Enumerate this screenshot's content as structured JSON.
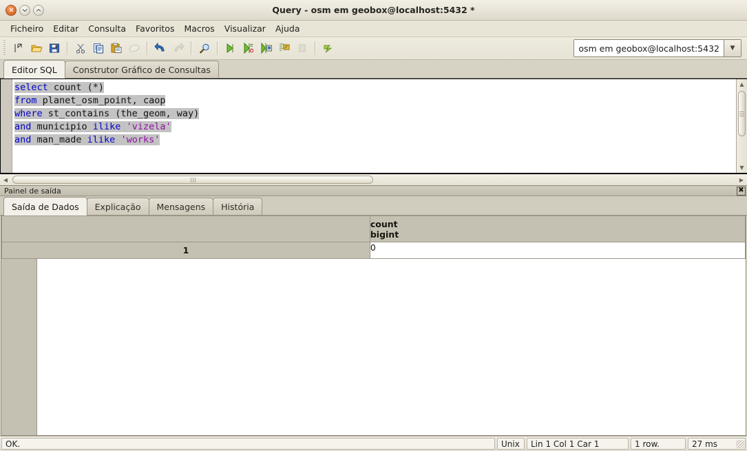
{
  "window": {
    "title": "Query - osm em geobox@localhost:5432 *",
    "buttons": {
      "close": "close-button",
      "minimize": "minimize-button",
      "maximize": "maximize-button"
    }
  },
  "menubar": {
    "items": [
      {
        "label": "Ficheiro"
      },
      {
        "label": "Editar"
      },
      {
        "label": "Consulta"
      },
      {
        "label": "Favoritos"
      },
      {
        "label": "Macros"
      },
      {
        "label": "Visualizar"
      },
      {
        "label": "Ajuda"
      }
    ]
  },
  "toolbar": {
    "connection": {
      "value": "osm em geobox@localhost:5432",
      "arrow": "▼"
    },
    "buttons": [
      {
        "name": "new-query-icon",
        "enabled": true
      },
      {
        "name": "open-file-icon",
        "enabled": true
      },
      {
        "name": "save-file-icon",
        "enabled": true
      },
      {
        "name": "cut-icon",
        "enabled": true
      },
      {
        "name": "copy-icon",
        "enabled": true
      },
      {
        "name": "paste-icon",
        "enabled": true
      },
      {
        "name": "clear-window-icon",
        "enabled": false
      },
      {
        "name": "undo-icon",
        "enabled": true
      },
      {
        "name": "redo-icon",
        "enabled": false
      },
      {
        "name": "find-replace-icon",
        "enabled": true
      },
      {
        "name": "execute-query-icon",
        "enabled": true
      },
      {
        "name": "execute-pgscript-icon",
        "enabled": true
      },
      {
        "name": "execute-to-file-icon",
        "enabled": true
      },
      {
        "name": "explain-query-icon",
        "enabled": true
      },
      {
        "name": "cancel-query-icon",
        "enabled": false
      },
      {
        "name": "explain-options-icon",
        "enabled": true
      }
    ]
  },
  "editor": {
    "tabs": [
      {
        "label": "Editor SQL",
        "active": true
      },
      {
        "label": "Construtor Gráfico de Consultas",
        "active": false
      }
    ],
    "sql_lines": [
      [
        {
          "t": "select",
          "c": "kw"
        },
        {
          "t": " count (*)",
          "c": "plain"
        }
      ],
      [
        {
          "t": "from",
          "c": "kw"
        },
        {
          "t": " planet_osm_point, caop",
          "c": "plain"
        }
      ],
      [
        {
          "t": "where",
          "c": "kw"
        },
        {
          "t": " st_contains (the_geom, way)",
          "c": "plain"
        }
      ],
      [
        {
          "t": "and",
          "c": "kw"
        },
        {
          "t": " municipio ",
          "c": "plain"
        },
        {
          "t": "ilike",
          "c": "kw"
        },
        {
          "t": " ",
          "c": "plain"
        },
        {
          "t": "'vizela'",
          "c": "str"
        }
      ],
      [
        {
          "t": "and",
          "c": "kw"
        },
        {
          "t": " man_made ",
          "c": "plain"
        },
        {
          "t": "ilike",
          "c": "kw"
        },
        {
          "t": " ",
          "c": "plain"
        },
        {
          "t": "'works'",
          "c": "str"
        }
      ]
    ],
    "colors": {
      "keyword": "#0000c8",
      "string": "#9010a0",
      "plain": "#111111",
      "selection": "#c3c3c3"
    }
  },
  "output_panel": {
    "title": "Painel de saída",
    "close_label": "✖",
    "tabs": [
      {
        "label": "Saída de Dados",
        "active": true
      },
      {
        "label": "Explicação",
        "active": false
      },
      {
        "label": "Mensagens",
        "active": false
      },
      {
        "label": "História",
        "active": false
      }
    ],
    "grid": {
      "columns": [
        {
          "name": "count",
          "type": "bigint"
        }
      ],
      "rows": [
        {
          "num": "1",
          "values": [
            "0"
          ]
        }
      ]
    }
  },
  "statusbar": {
    "message": "OK.",
    "eol": "Unix",
    "position": "Lin 1 Col 1 Car 1",
    "rows": "1 row.",
    "time": "27 ms"
  }
}
